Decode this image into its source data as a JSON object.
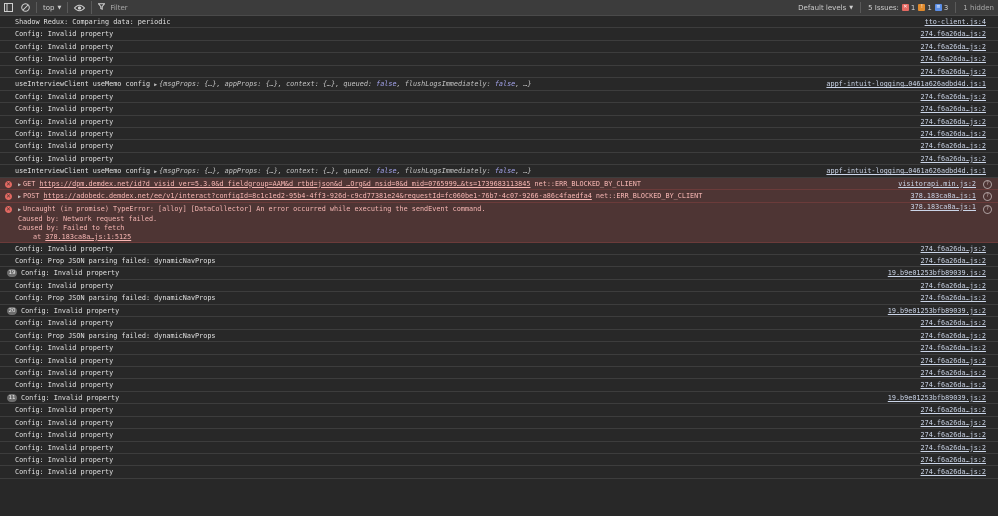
{
  "toolbar": {
    "context": "top",
    "filter_placeholder": "Filter",
    "levels": "Default levels",
    "issues_label": "5 Issues:",
    "issue_counts": [
      "1",
      "1",
      "3"
    ],
    "hidden": "1 hidden"
  },
  "rows": [
    {
      "type": "log",
      "text": "Shadow Redux: Comparing data: periodic",
      "src": "tto-client.js:4"
    },
    {
      "type": "log",
      "text": "Config: Invalid property",
      "src": "274.f6a26da…js:2"
    },
    {
      "type": "log",
      "text": "Config: Invalid property",
      "src": "274.f6a26da…js:2"
    },
    {
      "type": "log",
      "text": "Config: Invalid property",
      "src": "274.f6a26da…js:2"
    },
    {
      "type": "log",
      "text": "Config: Invalid property",
      "src": "274.f6a26da…js:2"
    },
    {
      "type": "memo",
      "text": "useInterviewClient useMemo config",
      "src": "appf-intuit-logging…0461a626adbd4d.js:1"
    },
    {
      "type": "log",
      "text": "Config: Invalid property",
      "src": "274.f6a26da…js:2"
    },
    {
      "type": "log",
      "text": "Config: Invalid property",
      "src": "274.f6a26da…js:2"
    },
    {
      "type": "log",
      "text": "Config: Invalid property",
      "src": "274.f6a26da…js:2"
    },
    {
      "type": "log",
      "text": "Config: Invalid property",
      "src": "274.f6a26da…js:2"
    },
    {
      "type": "log",
      "text": "Config: Invalid property",
      "src": "274.f6a26da…js:2"
    },
    {
      "type": "log",
      "text": "Config: Invalid property",
      "src": "274.f6a26da…js:2"
    },
    {
      "type": "memo",
      "text": "useInterviewClient useMemo config",
      "src": "appf-intuit-logging…0461a626adbd4d.js:1"
    },
    {
      "type": "neterr",
      "method": "GET",
      "url": "https://dpm.demdex.net/id?d_visid_ver=5.3.0&d_fieldgroup=AAM&d_rtbd=json&d_…Org&d_nsid=0&d_mid=0765999…&ts=1739683113845",
      "status": "net::ERR_BLOCKED_BY_CLIENT",
      "src": "visitorapi.min.js:2"
    },
    {
      "type": "neterr",
      "method": "POST",
      "url": "https://adobedc.demdex.net/ee/v1/interact?configId=8c1c1ed2-95b4-4ff3-926d-c9cd77381e24&requestId=fc060be1-76b7-4c07-9266-a86c4faedfa4",
      "status": "net::ERR_BLOCKED_BY_CLIENT",
      "src": "378.183ca8a…js:1"
    },
    {
      "type": "uncaught",
      "lines": [
        "Uncaught (in promise) TypeError: [alloy] [DataCollector] An error occurred while executing the sendEvent command.",
        "Caused by: Network request failed.",
        "Caused by: Failed to fetch"
      ],
      "at_prefix": "at ",
      "at_link": "378.183ca8a…js:1:5125",
      "src": "378.183ca8a…js:1"
    },
    {
      "type": "log",
      "text": "Config: Invalid property",
      "src": "274.f6a26da…js:2"
    },
    {
      "type": "log",
      "text": "Config: Prop JSON parsing failed: dynamicNavProps",
      "src": "274.f6a26da…js:2"
    },
    {
      "type": "count",
      "count": "19",
      "text": "Config: Invalid property",
      "src": "19.b9e01253bfb89039.js:2"
    },
    {
      "type": "log",
      "text": "Config: Invalid property",
      "src": "274.f6a26da…js:2"
    },
    {
      "type": "log",
      "text": "Config: Prop JSON parsing failed: dynamicNavProps",
      "src": "274.f6a26da…js:2"
    },
    {
      "type": "count",
      "count": "20",
      "text": "Config: Invalid property",
      "src": "19.b9e01253bfb89039.js:2"
    },
    {
      "type": "log",
      "text": "Config: Invalid property",
      "src": "274.f6a26da…js:2"
    },
    {
      "type": "log",
      "text": "Config: Prop JSON parsing failed: dynamicNavProps",
      "src": "274.f6a26da…js:2"
    },
    {
      "type": "log",
      "text": "Config: Invalid property",
      "src": "274.f6a26da…js:2"
    },
    {
      "type": "log",
      "text": "Config: Invalid property",
      "src": "274.f6a26da…js:2"
    },
    {
      "type": "log",
      "text": "Config: Invalid property",
      "src": "274.f6a26da…js:2"
    },
    {
      "type": "log",
      "text": "Config: Invalid property",
      "src": "274.f6a26da…js:2"
    },
    {
      "type": "count",
      "count": "11",
      "text": "Config: Invalid property",
      "src": "19.b9e01253bfb89039.js:2"
    },
    {
      "type": "log",
      "text": "Config: Invalid property",
      "src": "274.f6a26da…js:2"
    },
    {
      "type": "log",
      "text": "Config: Invalid property",
      "src": "274.f6a26da…js:2"
    },
    {
      "type": "log",
      "text": "Config: Invalid property",
      "src": "274.f6a26da…js:2"
    },
    {
      "type": "log",
      "text": "Config: Invalid property",
      "src": "274.f6a26da…js:2"
    },
    {
      "type": "log",
      "text": "Config: Invalid property",
      "src": "274.f6a26da…js:2"
    },
    {
      "type": "log",
      "text": "Config: Invalid property",
      "src": "274.f6a26da…js:2"
    }
  ],
  "memo_object": {
    "brace_open": "{",
    "parts": [
      {
        "key": "msgProps",
        "val": "{…}"
      },
      {
        "key": "appProps",
        "val": "{…}"
      },
      {
        "key": "context",
        "val": "{…}"
      },
      {
        "key": "queued",
        "val": "false",
        "kw": true
      },
      {
        "key": "flushLogsImmediately",
        "val": "false",
        "kw": true
      }
    ],
    "tail": "…}"
  },
  "colors": {
    "background": "#282828",
    "error_bg": "#4e3534",
    "error_text": "#f9b8b5",
    "keyword": "#a7a7f2"
  }
}
